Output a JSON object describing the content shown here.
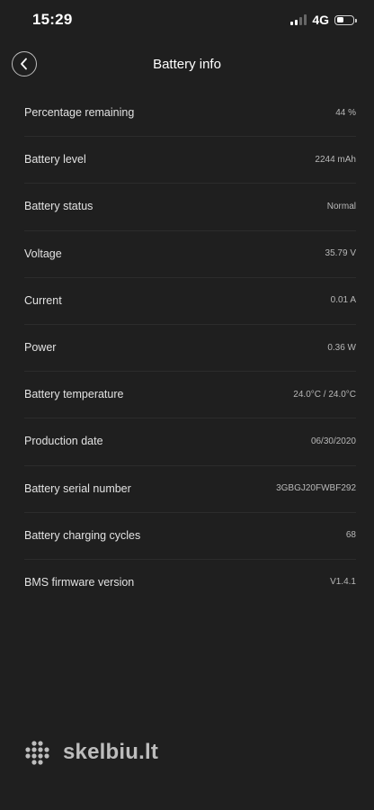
{
  "status_bar": {
    "time": "15:29",
    "network": "4G"
  },
  "header": {
    "title": "Battery info"
  },
  "rows": [
    {
      "label": "Percentage remaining",
      "value": "44 %"
    },
    {
      "label": "Battery level",
      "value": "2244 mAh"
    },
    {
      "label": "Battery status",
      "value": "Normal"
    },
    {
      "label": "Voltage",
      "value": "35.79 V"
    },
    {
      "label": "Current",
      "value": "0.01 A"
    },
    {
      "label": "Power",
      "value": "0.36 W"
    },
    {
      "label": "Battery temperature",
      "value": "24.0°C / 24.0°C"
    },
    {
      "label": "Production date",
      "value": "06/30/2020"
    },
    {
      "label": "Battery serial number",
      "value": "3GBGJ20FWBF292"
    },
    {
      "label": "Battery charging cycles",
      "value": "68"
    },
    {
      "label": "BMS firmware version",
      "value": "V1.4.1"
    }
  ],
  "watermark": {
    "text": "skelbiu.lt"
  },
  "icons": {
    "back": "chevron-left-icon",
    "signal": "cellular-signal-icon",
    "battery": "battery-icon"
  },
  "colors": {
    "background": "#1f1f1f",
    "text_primary": "#ffffff",
    "text_secondary": "#b8b8b8"
  }
}
